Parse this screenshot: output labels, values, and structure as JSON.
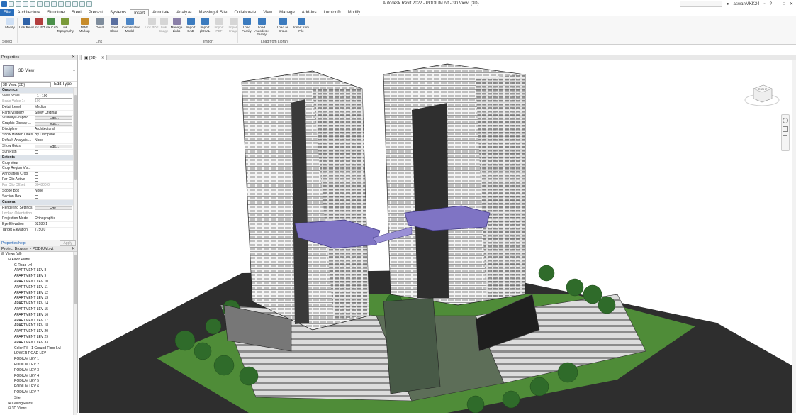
{
  "window": {
    "title": "Autodesk Revit 2022 - PODIUM.rvt - 3D View: {3D}",
    "user": "aswanMKK24",
    "help": "?"
  },
  "menu": [
    "File",
    "Architecture",
    "Structure",
    "Steel",
    "Precast",
    "Systems",
    "Insert",
    "Annotate",
    "Analyze",
    "Massing & Site",
    "Collaborate",
    "View",
    "Manage",
    "Add-Ins",
    "Lumion®",
    "Modify"
  ],
  "ribbon": {
    "buttons": [
      {
        "label": "Modify",
        "color": "#cfe0f5"
      },
      {
        "label": "Link Revit",
        "color": "#2f62a8"
      },
      {
        "label": "Link IFC",
        "color": "#b23d3d"
      },
      {
        "label": "Link CAD",
        "color": "#4a8f4a"
      },
      {
        "label": "Link Topography",
        "color": "#7a9a3a"
      },
      {
        "label": "DWF Markup",
        "color": "#c78b2a"
      },
      {
        "label": "Decal",
        "color": "#7e8c9c"
      },
      {
        "label": "Point Cloud",
        "color": "#5a6fa0"
      },
      {
        "label": "Coordination Model",
        "color": "#4d86c6"
      },
      {
        "label": "Link PDF",
        "color": "#999",
        "dim": true
      },
      {
        "label": "Link Image",
        "color": "#999",
        "dim": true
      },
      {
        "label": "Manage Links",
        "color": "#8a7fa8"
      },
      {
        "label": "Import CAD",
        "color": "#3b7bbf"
      },
      {
        "label": "Import gbXML",
        "color": "#3b7bbf"
      },
      {
        "label": "Import PDF",
        "color": "#999",
        "dim": true
      },
      {
        "label": "Import Image",
        "color": "#999",
        "dim": true
      },
      {
        "label": "Load Family",
        "color": "#3b7bbf"
      },
      {
        "label": "Load Autodesk Family",
        "color": "#3b7bbf"
      },
      {
        "label": "Load as Group",
        "color": "#3b7bbf"
      },
      {
        "label": "Insert from File",
        "color": "#3b7bbf"
      }
    ],
    "panels": [
      "Select",
      "Link",
      "Import",
      "Load from Library"
    ]
  },
  "properties": {
    "title": "Properties",
    "type_name": "3D View",
    "instance": "3D View: {3D}",
    "edit_type": "Edit Type",
    "rows": [
      {
        "k": "Graphics",
        "grp": true
      },
      {
        "k": "View Scale",
        "v": "1 : 100",
        "box": true
      },
      {
        "k": "Scale Value  1:",
        "v": "100",
        "grey": true
      },
      {
        "k": "Detail Level",
        "v": "Medium"
      },
      {
        "k": "Parts Visibility",
        "v": "Show Original"
      },
      {
        "k": "Visibility/Graphic...",
        "v": "Edit...",
        "btn": true
      },
      {
        "k": "Graphic Display ...",
        "v": "Edit...",
        "btn": true
      },
      {
        "k": "Discipline",
        "v": "Architectural"
      },
      {
        "k": "Show Hidden Lines",
        "v": "By Discipline"
      },
      {
        "k": "Default Analysis ...",
        "v": "None"
      },
      {
        "k": "Show Grids",
        "v": "Edit...",
        "btn": true
      },
      {
        "k": "Sun Path",
        "cb": true
      },
      {
        "k": "Extents",
        "grp": true
      },
      {
        "k": "Crop View",
        "cb": true
      },
      {
        "k": "Crop Region Vis...",
        "cb": true
      },
      {
        "k": "Annotation Crop",
        "cb": true
      },
      {
        "k": "Far Clip Active",
        "cb": true
      },
      {
        "k": "Far Clip Offset",
        "v": "304800.0",
        "grey": true
      },
      {
        "k": "Scope Box",
        "v": "None"
      },
      {
        "k": "Section Box",
        "cb": true
      },
      {
        "k": "Camera",
        "grp": true
      },
      {
        "k": "Rendering Settings",
        "v": "Edit...",
        "btn": true
      },
      {
        "k": "Locked Orientation",
        "v": "",
        "grey": true
      },
      {
        "k": "Projection Mode",
        "v": "Orthographic"
      },
      {
        "k": "Eye Elevation",
        "v": "62180.1"
      },
      {
        "k": "Target Elevation",
        "v": "7750.0"
      }
    ],
    "help": "Properties help",
    "apply": "Apply"
  },
  "browser": {
    "title": "Project Browser - PODIUM.rvt",
    "nodes": [
      {
        "t": "Views (all)",
        "l": 0,
        "e": "−"
      },
      {
        "t": "Floor Plans",
        "l": 1,
        "e": "−"
      },
      {
        "t": "G Road Lvl",
        "l": 2
      },
      {
        "t": "APARTMENT LEV 8",
        "l": 2
      },
      {
        "t": "APARTMENT LEV 9",
        "l": 2
      },
      {
        "t": "APARTMENT LEV 10",
        "l": 2
      },
      {
        "t": "APARTMENT LEV 11",
        "l": 2
      },
      {
        "t": "APARTMENT LEV 12",
        "l": 2
      },
      {
        "t": "APARTMENT LEV 13",
        "l": 2
      },
      {
        "t": "APARTMENT LEV 14",
        "l": 2
      },
      {
        "t": "APARTMENT LEV 15",
        "l": 2
      },
      {
        "t": "APARTMENT LEV 16",
        "l": 2
      },
      {
        "t": "APARTMENT LEV 17",
        "l": 2
      },
      {
        "t": "APARTMENT LEV 18",
        "l": 2
      },
      {
        "t": "APARTMENT LEV 20",
        "l": 2
      },
      {
        "t": "APARTMENT LEV 29",
        "l": 2
      },
      {
        "t": "APARTMENT LEV 33",
        "l": 2
      },
      {
        "t": "Color Fill - 1 Ground Floor Lvl",
        "l": 2
      },
      {
        "t": "LOWER ROAD LEV",
        "l": 2
      },
      {
        "t": "PODIUM LEV 1",
        "l": 2
      },
      {
        "t": "PODIUM LEV 2",
        "l": 2
      },
      {
        "t": "PODIUM LEV 3",
        "l": 2
      },
      {
        "t": "PODIUM LEV 4",
        "l": 2
      },
      {
        "t": "PODIUM LEV 5",
        "l": 2
      },
      {
        "t": "PODIUM LEV 6",
        "l": 2
      },
      {
        "t": "PODIUM LEV 7",
        "l": 2
      },
      {
        "t": "Site",
        "l": 2
      },
      {
        "t": "Ceiling Plans",
        "l": 1,
        "e": "+"
      },
      {
        "t": "3D Views",
        "l": 1,
        "e": "−"
      }
    ]
  },
  "view_tab": {
    "label": "{3D}"
  },
  "viewcube": {
    "label": "RIGHT"
  }
}
